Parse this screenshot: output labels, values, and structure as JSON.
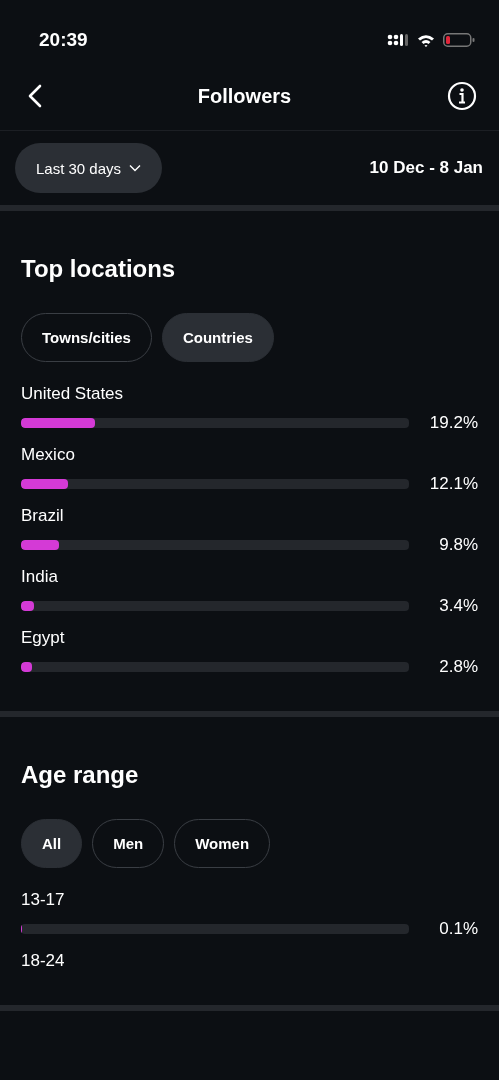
{
  "status_bar": {
    "time": "20:39"
  },
  "header": {
    "title": "Followers"
  },
  "filter": {
    "period": "Last 30 days",
    "date_range": "10 Dec - 8 Jan"
  },
  "sections": [
    {
      "title": "Top locations",
      "tabs": [
        {
          "label": "Towns/cities",
          "selected": false
        },
        {
          "label": "Countries",
          "selected": true
        }
      ],
      "rows": [
        {
          "label": "United States",
          "level": 0.192,
          "value": "19.2%"
        },
        {
          "label": "Mexico",
          "level": 0.121,
          "value": "12.1%"
        },
        {
          "label": "Brazil",
          "level": 0.098,
          "value": "9.8%"
        },
        {
          "label": "India",
          "level": 0.034,
          "value": "3.4%"
        },
        {
          "label": "Egypt",
          "level": 0.028,
          "value": "2.8%"
        }
      ]
    },
    {
      "title": "Age range",
      "tabs": [
        {
          "label": "All",
          "selected": true
        },
        {
          "label": "Men",
          "selected": false
        },
        {
          "label": "Women",
          "selected": false
        }
      ],
      "rows": [
        {
          "label": "13-17",
          "level": 0.001,
          "value": "0.1%"
        },
        {
          "label": "18-24"
        }
      ]
    }
  ]
}
